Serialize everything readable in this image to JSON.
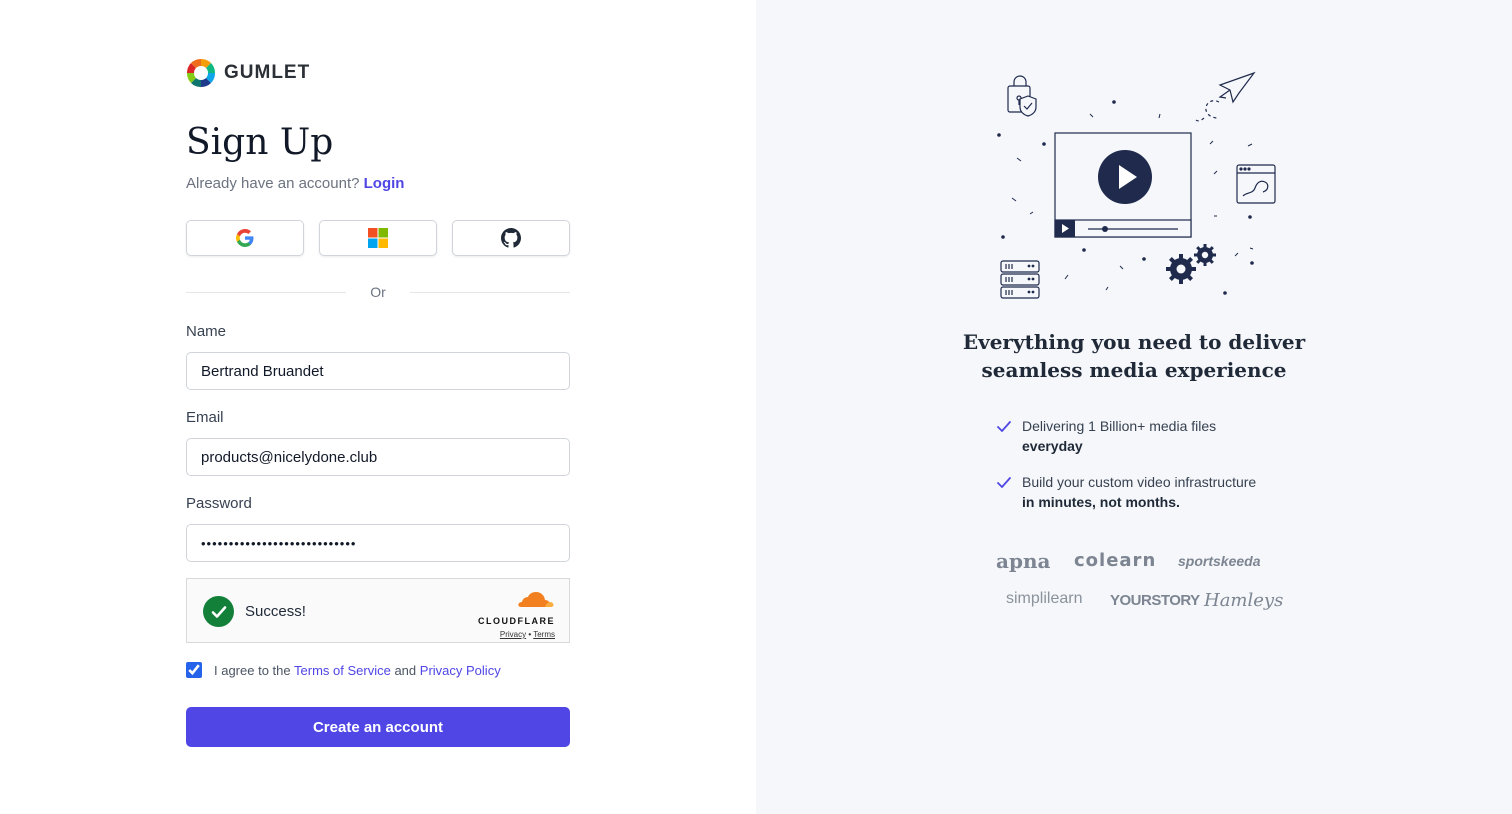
{
  "brand": {
    "name": "GUMLET"
  },
  "signup": {
    "title": "Sign Up",
    "have_account": "Already have an account?",
    "login_link": "Login",
    "divider": "Or"
  },
  "social": [
    "google-icon",
    "microsoft-icon",
    "github-icon"
  ],
  "form": {
    "name_label": "Name",
    "name_value": "Bertrand Bruandet",
    "email_label": "Email",
    "email_value": "products@nicelydone.club",
    "password_label": "Password",
    "password_value": "••••••••••••••••••••••••••••"
  },
  "captcha": {
    "status": "Success!",
    "provider": "CLOUDFLARE",
    "privacy": "Privacy",
    "separator": "•",
    "terms": "Terms"
  },
  "agree": {
    "checked": true,
    "prefix": "I agree to the",
    "terms_link": "Terms of Service",
    "middle": "and",
    "privacy_link": "Privacy Policy"
  },
  "submit_label": "Create an account",
  "promo": {
    "headline_line1": "Everything you need to deliver",
    "headline_line2": "seamless media experience",
    "features": [
      {
        "text": "Delivering 1 Billion+ media files",
        "bold": "everyday"
      },
      {
        "text": "Build your custom video infrastructure",
        "bold": "in minutes, not months."
      }
    ],
    "customers": [
      "apna",
      "colearn",
      "sportskeeda",
      "simplilearn",
      "YOURSTORY",
      "Hamleys"
    ]
  },
  "colors": {
    "accent": "#4f46e5",
    "panel": "#f5f7fa",
    "illustration": "#1f2a4d",
    "success": "#13803a"
  }
}
